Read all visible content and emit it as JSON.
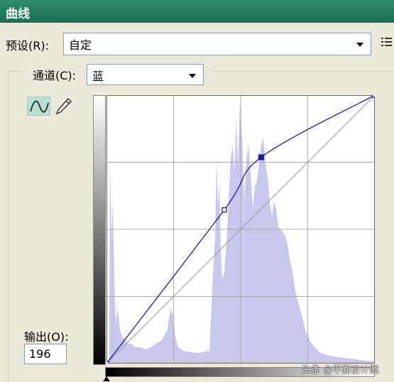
{
  "window": {
    "title": "曲线"
  },
  "preset": {
    "label": "预设(R):",
    "value": "自定"
  },
  "channel": {
    "label": "通道(C):",
    "value": "蓝"
  },
  "output": {
    "label": "输出(O):",
    "value": "196"
  },
  "curve_points": [
    {
      "input": 0,
      "output": 0
    },
    {
      "input": 112,
      "output": 146
    },
    {
      "input": 147,
      "output": 196
    },
    {
      "input": 255,
      "output": 255
    }
  ],
  "selected_point_index": 2,
  "colors": {
    "curve": "#1a1a9a",
    "histogram": "#c8c8ee",
    "grid": "#a9a9a9",
    "titlebar": "#1d6e55"
  },
  "icons": [
    "curve-tool-icon",
    "pencil-tool-icon",
    "list-menu-icon",
    "chevron-down-icon"
  ],
  "watermark": {
    "text": "头条 @平面设计图"
  }
}
